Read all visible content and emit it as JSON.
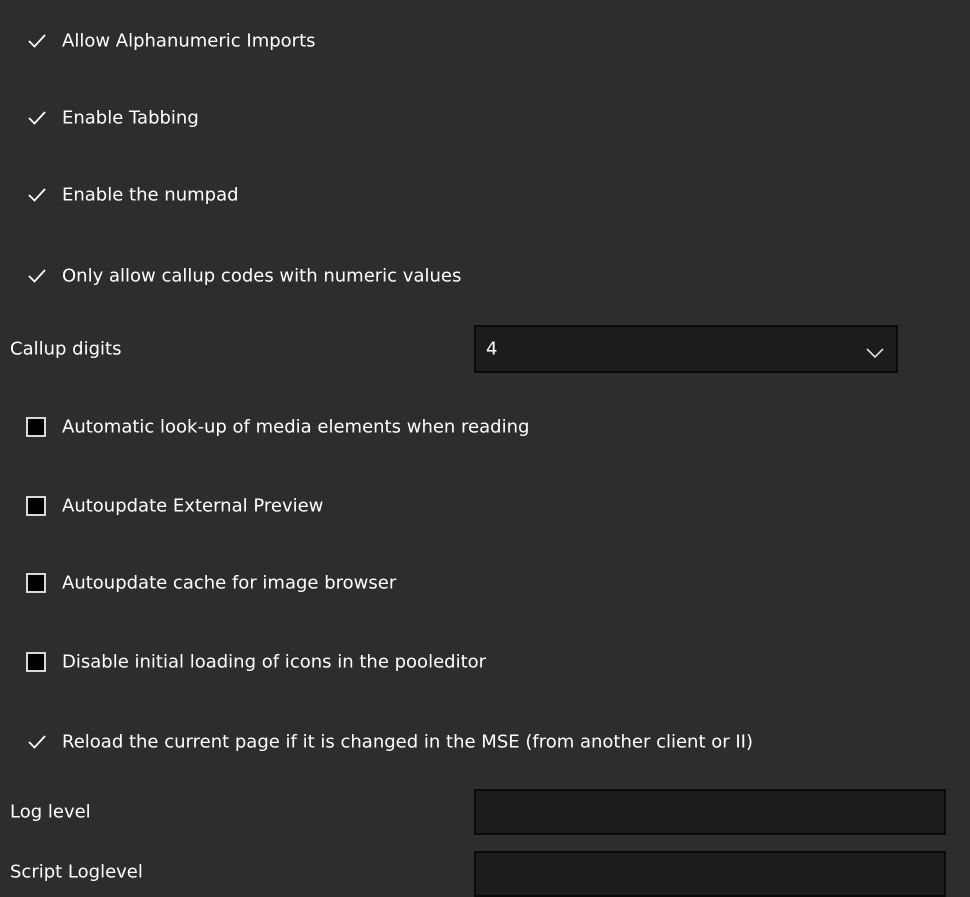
{
  "options": [
    {
      "label": "Allow Alphanumeric Imports",
      "checked": true
    },
    {
      "label": "Enable Tabbing",
      "checked": true
    },
    {
      "label": "Enable the numpad",
      "checked": true
    },
    {
      "label": "Only allow callup codes with numeric values",
      "checked": true
    },
    {
      "label": "Automatic look-up of media elements when reading",
      "checked": false
    },
    {
      "label": "Autoupdate External Preview",
      "checked": false
    },
    {
      "label": "Autoupdate cache for image browser",
      "checked": false
    },
    {
      "label": "Disable initial loading of icons in the pooleditor",
      "checked": false
    },
    {
      "label": "Reload the current page if it is changed in the MSE (from another client or II)",
      "checked": true
    }
  ],
  "callup_digits": {
    "label": "Callup digits",
    "value": "4"
  },
  "log_level": {
    "label": "Log level",
    "value": ""
  },
  "script_loglevel": {
    "label": "Script Loglevel",
    "value": ""
  },
  "colors": {
    "background": "#2d2d2d",
    "input_background": "#1c1c1c",
    "text": "#ffffff"
  }
}
